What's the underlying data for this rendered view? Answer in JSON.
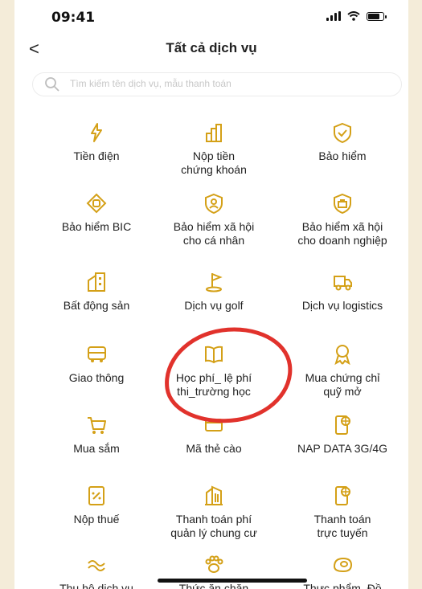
{
  "status": {
    "time": "09:41"
  },
  "header": {
    "title": "Tất cả dịch vụ",
    "back": "<"
  },
  "search": {
    "placeholder": "Tìm kiếm tên dịch vụ, mẫu thanh toán"
  },
  "services": [
    {
      "label": "Tiền điện",
      "icon": "lightning-icon"
    },
    {
      "label": "Nộp tiền\nchứng khoán",
      "icon": "bar-chart-icon"
    },
    {
      "label": "Bảo hiểm",
      "icon": "shield-check-icon"
    },
    {
      "label": "Bảo hiểm BIC",
      "icon": "diamond-icon"
    },
    {
      "label": "Bảo hiểm xã hội\ncho cá nhân",
      "icon": "shield-person-icon"
    },
    {
      "label": "Bảo hiểm xã hội\ncho doanh nghiệp",
      "icon": "shield-briefcase-icon"
    },
    {
      "label": "Bất động sản",
      "icon": "building-icon"
    },
    {
      "label": "Dịch vụ golf",
      "icon": "golf-flag-icon"
    },
    {
      "label": "Dịch vụ logistics",
      "icon": "truck-icon"
    },
    {
      "label": "Giao thông",
      "icon": "bus-icon"
    },
    {
      "label": "Học phí_ lệ phí\nthi_trường học",
      "icon": "book-icon"
    },
    {
      "label": "Mua chứng chỉ\nquỹ mở",
      "icon": "ribbon-icon"
    },
    {
      "label": "Mua sắm",
      "icon": "cart-icon"
    },
    {
      "label": "Mã thẻ cào",
      "icon": "card-icon"
    },
    {
      "label": "NAP DATA 3G/4G",
      "icon": "globe-phone-icon"
    },
    {
      "label": "Nộp thuế",
      "icon": "tax-icon"
    },
    {
      "label": "Thanh toán phí\nquản lý chung cư",
      "icon": "apartment-icon"
    },
    {
      "label": "Thanh toán\ntrực tuyến",
      "icon": "globe-phone-icon"
    },
    {
      "label": "Thu hộ dịch vụ",
      "icon": "wave-icon"
    },
    {
      "label": "Thức ăn chăn",
      "icon": "paw-icon"
    },
    {
      "label": "Thực phẩm, Đồ",
      "icon": "meat-icon"
    }
  ],
  "colors": {
    "accent": "#d4a017",
    "highlight": "#e1322c"
  }
}
